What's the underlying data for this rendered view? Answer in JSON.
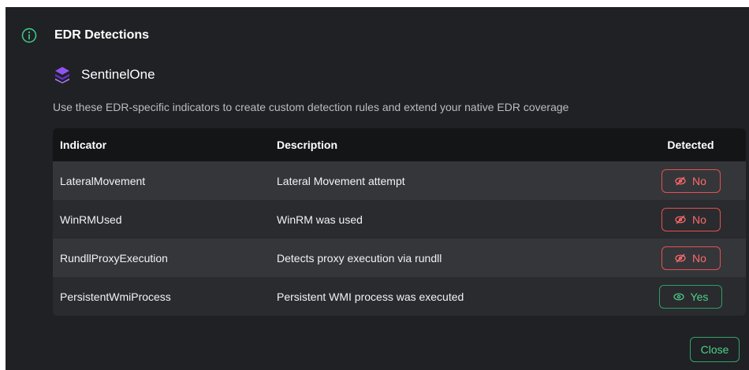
{
  "dialog": {
    "title": "EDR Detections",
    "info_icon": "info-circle-icon"
  },
  "vendor": {
    "name": "SentinelOne",
    "logo_icon": "sentinelone-logo-icon",
    "brand_color": "#7b3fe4"
  },
  "subtitle": "Use these EDR-specific indicators to create custom detection rules and extend your native EDR coverage",
  "table": {
    "headers": {
      "indicator": "Indicator",
      "description": "Description",
      "detected": "Detected"
    },
    "rows": [
      {
        "indicator": "LateralMovement",
        "description": "Lateral Movement attempt",
        "detected": "No",
        "detected_icon": "eye-off-icon"
      },
      {
        "indicator": "WinRMUsed",
        "description": "WinRM was used",
        "detected": "No",
        "detected_icon": "eye-off-icon"
      },
      {
        "indicator": "RundllProxyExecution",
        "description": "Detects proxy execution via rundll",
        "detected": "No",
        "detected_icon": "eye-off-icon"
      },
      {
        "indicator": "PersistentWmiProcess",
        "description": "Persistent WMI process was executed",
        "detected": "Yes",
        "detected_icon": "eye-icon"
      }
    ]
  },
  "colors": {
    "no": "#ff6b6b",
    "yes": "#4cd38a"
  },
  "footer": {
    "close_label": "Close"
  }
}
